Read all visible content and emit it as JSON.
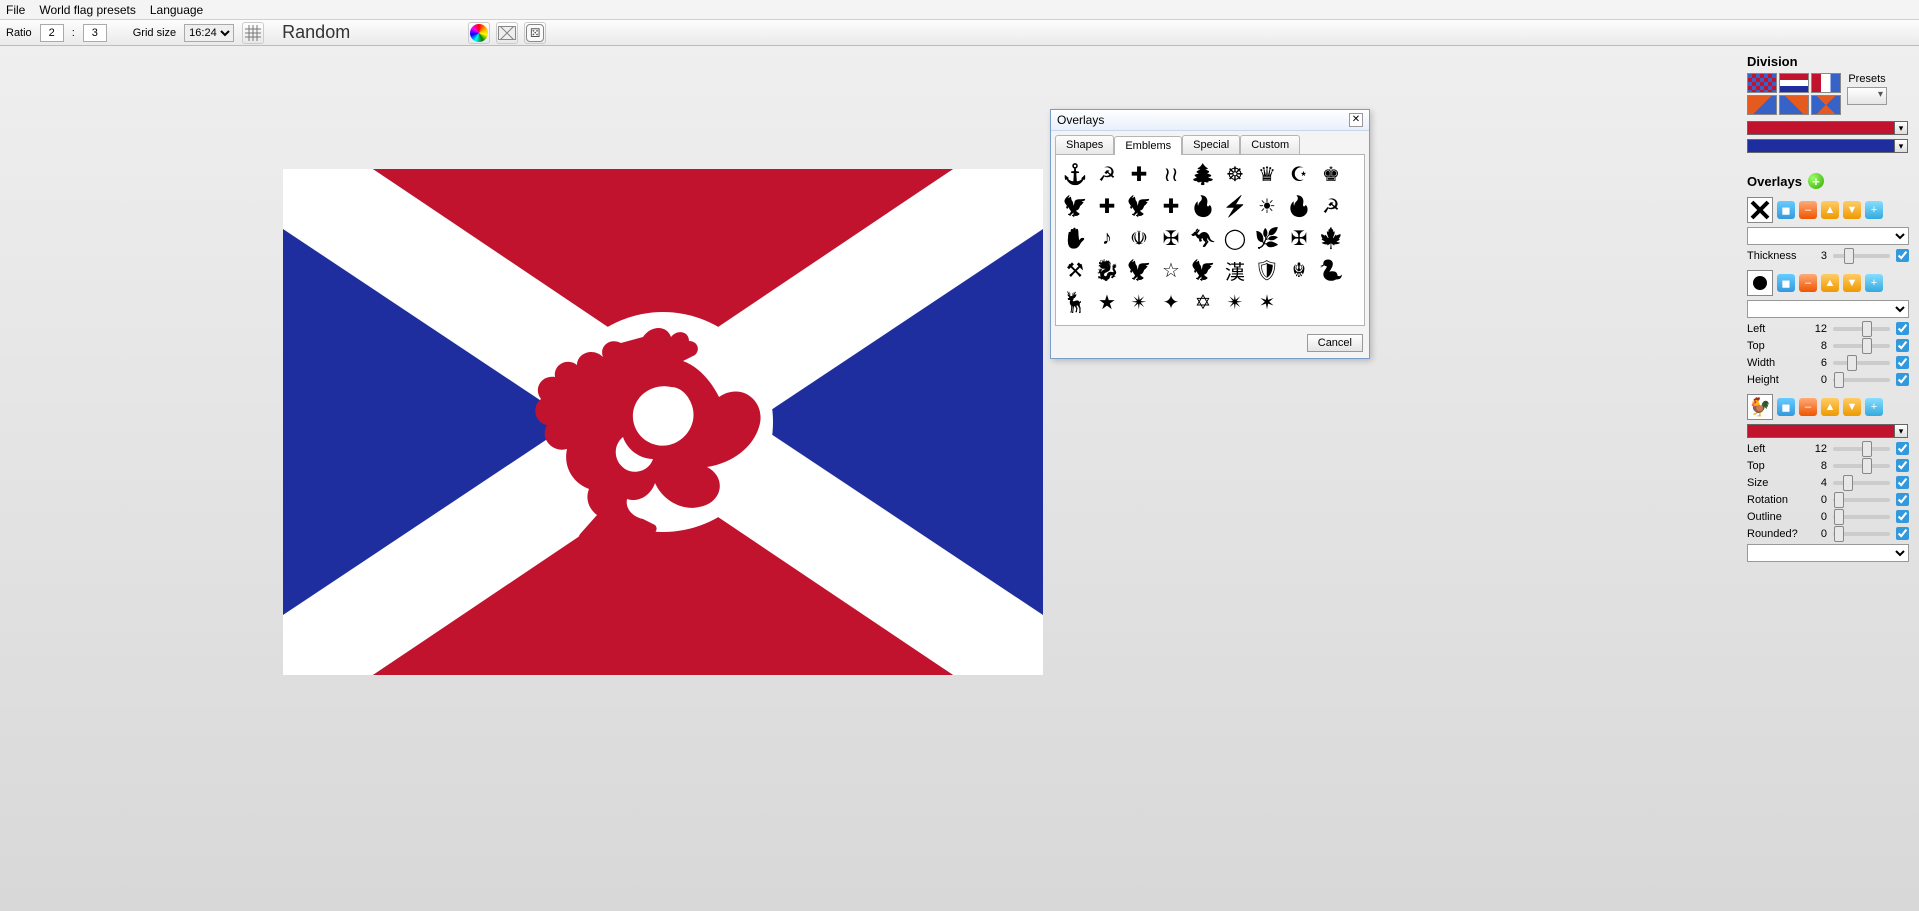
{
  "menu": {
    "file": "File",
    "presets": "World flag presets",
    "language": "Language"
  },
  "toolbar": {
    "ratio_label": "Ratio",
    "ratio_w": "2",
    "ratio_sep": ":",
    "ratio_h": "3",
    "gridsize_label": "Grid size",
    "gridsize_value": "16:24",
    "random_label": "Random"
  },
  "right": {
    "division_title": "Division",
    "presets_label": "Presets",
    "overlays_title": "Overlays",
    "o1": {
      "thickness_label": "Thickness",
      "thickness_value": "3"
    },
    "o2": {
      "left_label": "Left",
      "left_value": "12",
      "top_label": "Top",
      "top_value": "8",
      "width_label": "Width",
      "width_value": "6",
      "height_label": "Height",
      "height_value": "0"
    },
    "o3": {
      "left_label": "Left",
      "left_value": "12",
      "top_label": "Top",
      "top_value": "8",
      "size_label": "Size",
      "size_value": "4",
      "rotation_label": "Rotation",
      "rotation_value": "0",
      "outline_label": "Outline",
      "outline_value": "0",
      "rounded_label": "Rounded?",
      "rounded_value": "0"
    }
  },
  "popup": {
    "title": "Overlays",
    "tabs": {
      "shapes": "Shapes",
      "emblems": "Emblems",
      "special": "Special",
      "custom": "Custom"
    },
    "cancel": "Cancel"
  },
  "colors": {
    "red": "#C1132E",
    "blue": "#1F2E9E",
    "white": "#FFFFFF",
    "orange": "#E55A1F"
  },
  "flag": {
    "saltire_emblem": "rooster"
  },
  "emblem_names": [
    "anchor",
    "hammer-sickle",
    "iron-cross",
    "laurel-branches",
    "cedar-tree",
    "ashoka-chakra",
    "crown-royal",
    "crescent",
    "crown-imperial",
    "eagle-heraldic",
    "cross-bold",
    "eagle-emblem",
    "cross-plain",
    "flame",
    "lightning-bolt",
    "sun-rays",
    "torch",
    "hammer-sickle-2",
    "hand-palm",
    "harp",
    "iran-emblem",
    "cross-pattee",
    "kangaroo",
    "laurel-wreath",
    "fern",
    "maltese-cross",
    "maple-leaf",
    "pickaxe-cross",
    "dragon",
    "reichsadler",
    "star-outline",
    "eagle-spread",
    "cjk-text",
    "shield",
    "khanda",
    "snake",
    "springbok",
    "star-5",
    "star-8",
    "star-4",
    "star-of-david",
    "star-7",
    "star-6"
  ]
}
